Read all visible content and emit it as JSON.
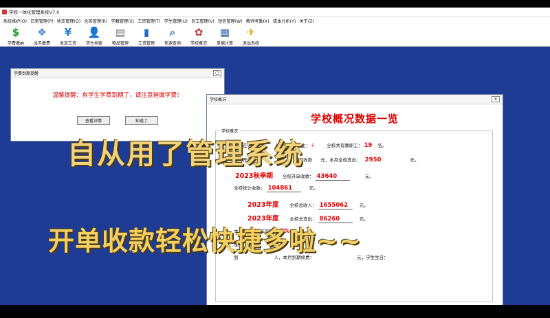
{
  "app": {
    "title": "学校一体化管理系统V7.0"
  },
  "menu": [
    "系统维护(O)",
    "日常管理(P)",
    "收支管理(Q)",
    "仓库管理(R)",
    "学籍管理(S)",
    "工资管理(T)",
    "学生管理(U)",
    "员工管理(V)",
    "短信管理(W)",
    "教师考勤(X)",
    "成本分析(Y)",
    "关于(Z)"
  ],
  "toolbar": [
    {
      "label": "学费缴纳",
      "icon": "dollar-icon",
      "glyph": "$",
      "color": "#1a9a2a"
    },
    {
      "label": "当天缴费",
      "icon": "coins-icon",
      "glyph": "❖",
      "color": "#4a7fd0"
    },
    {
      "label": "发放工资",
      "icon": "money-icon",
      "glyph": "¥",
      "color": "#2c7fc9"
    },
    {
      "label": "学生档案",
      "icon": "person-icon",
      "glyph": "👤",
      "color": "#333333"
    },
    {
      "label": "物品管理",
      "icon": "box-icon",
      "glyph": "▤",
      "color": "#777777"
    },
    {
      "label": "工资管理",
      "icon": "chart-icon",
      "glyph": "▮",
      "color": "#2a6bc0"
    },
    {
      "label": "快速查询",
      "icon": "search-icon",
      "glyph": "⌕",
      "color": "#2a6bc0"
    },
    {
      "label": "学校概况",
      "icon": "school-icon",
      "glyph": "✿",
      "color": "#c03a3a"
    },
    {
      "label": "单据计算",
      "icon": "calculator-icon",
      "glyph": "▦",
      "color": "#3a6aa0"
    },
    {
      "label": "退出系统",
      "icon": "exit-icon",
      "glyph": "✈",
      "color": "#d6a000"
    }
  ],
  "reminder_window": {
    "title": "学费到期提醒",
    "message": "温馨提醒：有学生学费到期了，请注意催缴学费！",
    "details_button": "查看详情",
    "ok_button": "知道了"
  },
  "overview_window": {
    "title": "学校概况",
    "heading": "学校概况数据一览",
    "group_label": "学校概况",
    "row1_left": "全校在读学生",
    "row1_mid": "人，本学期新生：",
    "row1_mid_value": "5",
    "row1_right": "全校共有教职工：",
    "row1_staff": "19",
    "row1_unit": "名。",
    "row2_left": "本月开单",
    "row2_mid": "本月收款",
    "row2_right": "元，本月全校支出：",
    "row2_expense": "2950",
    "row2_unit": "元。",
    "term_label": "2023秋季期",
    "term_income_label": "全校开单收款：",
    "term_income": "43640",
    "term_unit": "元。",
    "total_label": "全校统计收款：",
    "total_value": "104861",
    "total_unit": "元。",
    "year1_label": "2023年度",
    "year1_desc": "全校总收入：",
    "year1_value": "1655062",
    "year1_unit": "元。",
    "year2_label": "2023年度",
    "year2_desc": "全校总支出：",
    "year2_value": "86260",
    "year2_unit": "元。",
    "ratio_label": "本月开单比去年同比：",
    "ratio_value": "0%",
    "row_tail_left": "本",
    "row_last_left": "到",
    "row_last_mid": "人，本月到期续费：",
    "row_last_right": "元，学生生日："
  },
  "overlay": {
    "line1": "自从用了管理系统",
    "line2": "开单收款轻松快捷多啦~~"
  }
}
